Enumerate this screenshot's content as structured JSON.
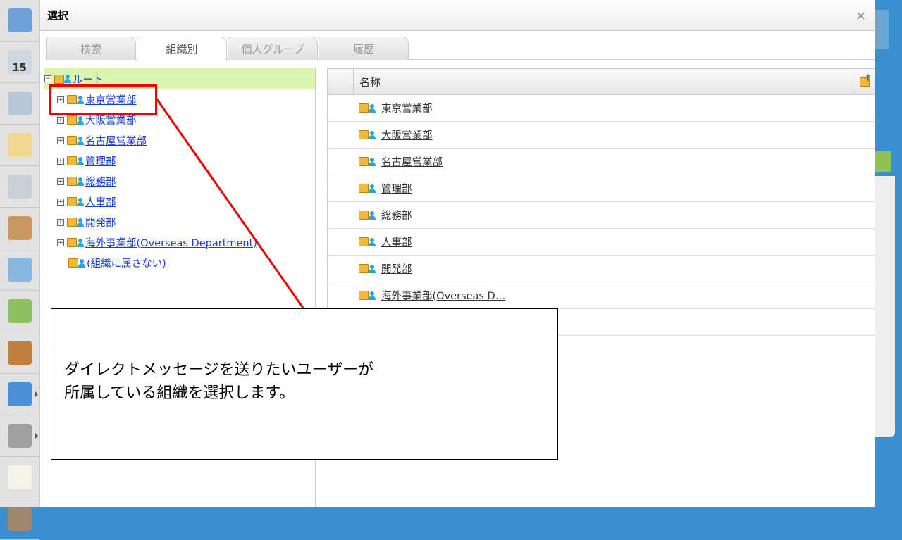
{
  "sidebar": {
    "items": [
      {
        "icon": "portal-icon",
        "color": "#6fa0d8"
      },
      {
        "icon": "calendar-icon",
        "label": "15",
        "color": "#cfd8e0"
      },
      {
        "icon": "facility-icon",
        "color": "#b8c8d8"
      },
      {
        "icon": "memo-icon",
        "color": "#f0d890"
      },
      {
        "icon": "bulletin-icon",
        "color": "#c8d0d8"
      },
      {
        "icon": "clipboard-icon",
        "color": "#c89860"
      },
      {
        "icon": "search-doc-icon",
        "color": "#88b8e0"
      },
      {
        "icon": "workflow-icon",
        "color": "#8cc060"
      },
      {
        "icon": "binder-icon",
        "color": "#c08040"
      },
      {
        "icon": "neo-icon",
        "color": "#4a90d8"
      },
      {
        "icon": "folder-icon",
        "color": "#a0a0a0"
      },
      {
        "icon": "tanomail-icon",
        "color": "#f4f4e8"
      },
      {
        "icon": "banner-icon",
        "color": "#a08870"
      }
    ]
  },
  "dialog": {
    "title": "選択",
    "close": "×"
  },
  "tabs": [
    {
      "label": "検索"
    },
    {
      "label": "組織別",
      "active": true
    },
    {
      "label": "個人グループ"
    },
    {
      "label": "履歴"
    }
  ],
  "tree": {
    "root": "ルート",
    "items": [
      "東京営業部",
      "大阪営業部",
      "名古屋営業部",
      "管理部",
      "総務部",
      "人事部",
      "開発部",
      "海外事業部(Overseas Department)"
    ],
    "none": "(組織に属さない)"
  },
  "grid": {
    "header": "名称",
    "rows": [
      "東京営業部",
      "大阪営業部",
      "名古屋営業部",
      "管理部",
      "総務部",
      "人事部",
      "開発部",
      "海外事業部(Overseas D…"
    ]
  },
  "annotation": {
    "line1": "ダイレクトメッセージを送りたいユーザーが",
    "line2": "所属している組織を選択します。",
    "highlight_color": "#e00000"
  }
}
